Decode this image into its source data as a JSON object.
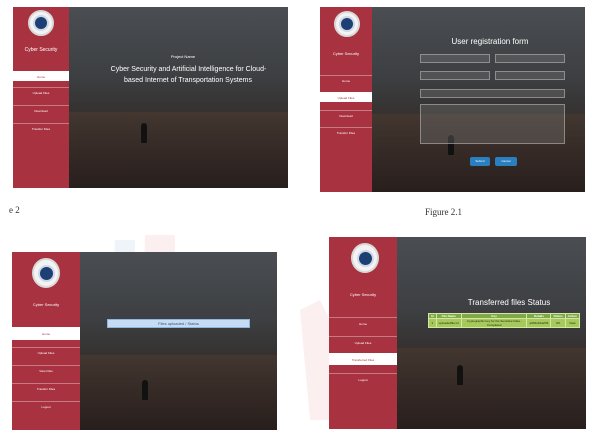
{
  "panels": {
    "p1": {
      "sidebar_title": "Cyber Security",
      "menu": [
        "Home",
        "Upload Files",
        "Download",
        "Transfer Files"
      ],
      "project_label": "Project Name",
      "project_title_line1": "Cyber Security and Artificial Intelligence for Cloud-",
      "project_title_line2": "based Internet of Transportation Systems"
    },
    "p2": {
      "sidebar_title": "Cyber Security",
      "menu": [
        "Home",
        "Upload Files",
        "Download",
        "Transfer Files"
      ],
      "form_title": "User registration form",
      "buttons": [
        "Submit",
        "Cancel"
      ]
    },
    "p3": {
      "sidebar_title": "Cyber Security",
      "menu": [
        "Home",
        "Upload Files",
        "View Files",
        "Transfer Files",
        "Logout"
      ],
      "banner_text": "Files uploaded / Status"
    },
    "p4": {
      "sidebar_title": "Cyber Security",
      "menu": [
        "Home",
        "Upload Files",
        "Transferred Files",
        "Logout"
      ],
      "table_title": "Transferred files Status",
      "table_headers": [
        "Id",
        "File Name",
        "Key",
        "Details",
        "Status",
        "Action"
      ],
      "table_row": [
        "1",
        "uploadedfile.txt",
        "cryptographic key for the Sensitive Data - Completed",
        "a3b5c2d4e5f6",
        "OK",
        "View"
      ]
    }
  },
  "captions": {
    "left_fragment": "e 2",
    "figure_2_1": "Figure 2.1"
  },
  "colors": {
    "sidebar": "#a8323f",
    "button": "#2a7fc0",
    "table_header": "#7fa84a"
  }
}
